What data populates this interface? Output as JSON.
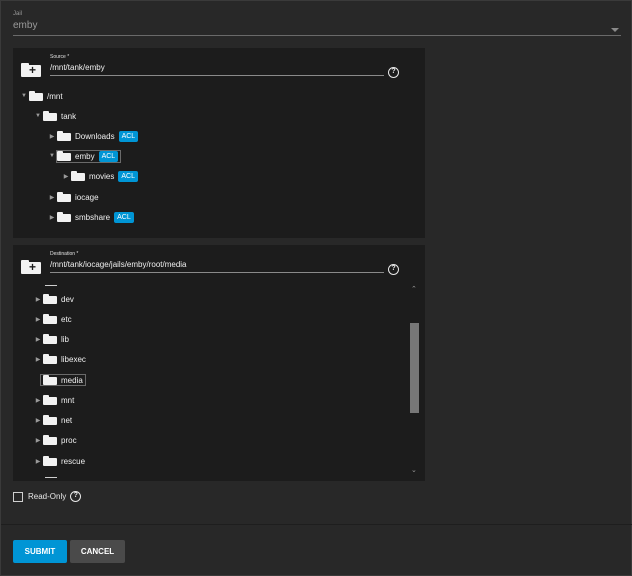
{
  "jail": {
    "label": "Jail",
    "value": "emby"
  },
  "source": {
    "label": "Source *",
    "value": "/mnt/tank/emby",
    "help": "?",
    "tree": [
      {
        "name": "/mnt",
        "acl": ""
      },
      {
        "name": "tank",
        "acl": ""
      },
      {
        "name": "Downloads",
        "acl": "ACL"
      },
      {
        "name": "emby",
        "acl": "ACL"
      },
      {
        "name": "movies",
        "acl": "ACL"
      },
      {
        "name": "iocage",
        "acl": ""
      },
      {
        "name": "smbshare",
        "acl": "ACL"
      }
    ]
  },
  "destination": {
    "label": "Destination *",
    "value": "/mnt/tank/iocage/jails/emby/root/media",
    "help": "?",
    "tree": [
      {
        "name": "dev"
      },
      {
        "name": "etc"
      },
      {
        "name": "lib"
      },
      {
        "name": "libexec"
      },
      {
        "name": "media"
      },
      {
        "name": "mnt"
      },
      {
        "name": "net"
      },
      {
        "name": "proc"
      },
      {
        "name": "rescue"
      }
    ]
  },
  "read_only": {
    "label": "Read-Only",
    "help": "?"
  },
  "buttons": {
    "submit": "SUBMIT",
    "cancel": "CANCEL"
  },
  "colors": {
    "accent": "#0095d5",
    "background": "#282828",
    "panel": "#1c1c1c"
  }
}
